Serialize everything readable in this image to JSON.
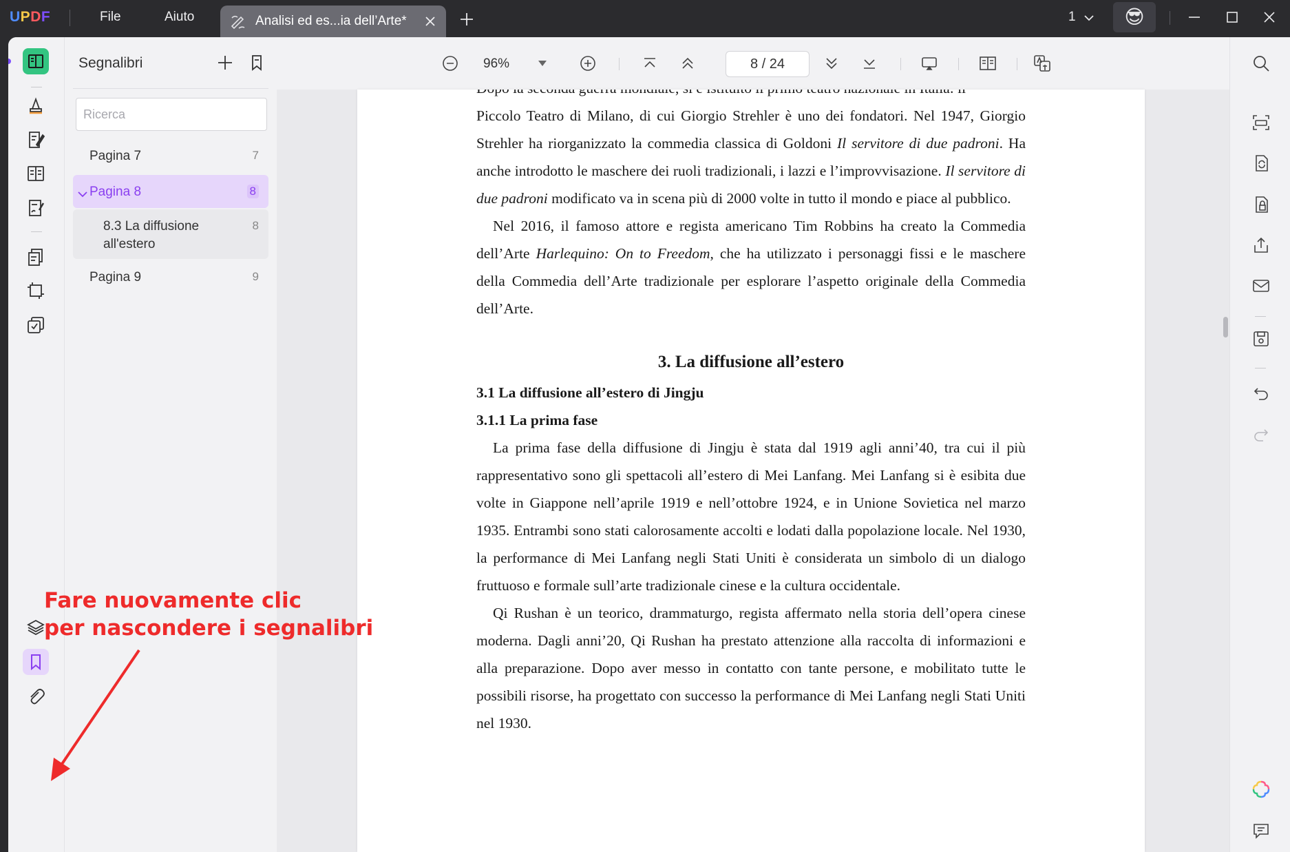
{
  "app": {
    "logo_letters": [
      {
        "char": "U",
        "color": "#4f8cff"
      },
      {
        "char": "P",
        "color": "#f7c948"
      },
      {
        "char": "D",
        "color": "#ff5a5f"
      },
      {
        "char": "F",
        "color": "#7c4dff"
      }
    ],
    "menu": [
      "File",
      "Aiuto"
    ],
    "tab_title": "Analisi ed es...ia dell’Arte*",
    "window_count": "1",
    "avatar_emoji": "😎"
  },
  "sidebar": {
    "title": "Segnalibri",
    "search_placeholder": "Ricerca",
    "bookmarks": [
      {
        "label": "Pagina 7",
        "page": "7"
      },
      {
        "label": "Pagina 8",
        "page": "8",
        "selected": true,
        "expanded": true
      },
      {
        "label": "8.3 La diffusione all'estero",
        "page": "8",
        "child": true
      },
      {
        "label": "Pagina 9",
        "page": "9"
      }
    ]
  },
  "toolbar": {
    "zoom": "96%",
    "page_indicator": "8  /  24"
  },
  "document": {
    "top_partial": "Dopo la seconda guerra mondiale, si è istituito il primo teatro nazionale in Italia: il",
    "p1_a": "Piccolo Teatro di Milano, di cui Giorgio Strehler è uno dei fondatori. Nel 1947, Giorgio Strehler ha riorganizzato la commedia classica di Goldoni ",
    "p1_i1": "Il servitore di due padroni",
    "p1_b": ". Ha anche introdotto le maschere dei ruoli tradizionali, i lazzi e l’improvvisazione. ",
    "p1_i2": "Il servitore di due padroni",
    "p1_c": " modificato va in scena più di 2000 volte in tutto il mondo e piace al pubblico.",
    "p2_a": "Nel 2016, il famoso attore e regista americano Tim Robbins ha creato la Commedia dell’Arte ",
    "p2_i": "Harlequino: On to Freedom",
    "p2_b": ", che ha utilizzato i personaggi fissi e le maschere della Commedia dell’Arte tradizionale per esplorare l’aspetto originale della Commedia dell’Arte.",
    "h_section": "3. La diffusione all’estero",
    "h_sub1": "3.1 La diffusione all’estero di Jingju",
    "h_sub2": "3.1.1 La prima fase",
    "p3": "La prima fase della diffusione di Jingju è stata dal 1919 agli anni’40, tra cui il più rappresentativo sono gli spettacoli all’estero di Mei Lanfang. Mei Lanfang si è esibita due volte in Giappone nell’aprile 1919 e nell’ottobre 1924, e in Unione Sovietica nel marzo 1935. Entrambi sono stati calorosamente accolti e lodati dalla popolazione locale. Nel 1930, la performance di Mei Lanfang negli Stati Uniti è considerata un simbolo di un dialogo fruttuoso e formale sull’arte tradizionale cinese e la cultura occidentale.",
    "p4": "Qi Rushan è un teorico, drammaturgo, regista affermato nella storia dell’opera cinese moderna. Dagli anni’20, Qi Rushan ha prestato attenzione alla raccolta di informazioni e alla preparazione. Dopo aver messo in contatto con tante persone, e mobilitato tutte le possibili risorse, ha progettato con successo la performance di Mei Lanfang negli Stati Uniti nel 1930."
  },
  "annotation": {
    "line1": "Fare nuovamente clic",
    "line2": "per nascondere i segnalibri",
    "color": "#ee2b2b"
  },
  "colors": {
    "accent": "#8a3ff0",
    "titlebar": "#2b2b2e",
    "selected_bg": "#e6d6fb"
  }
}
